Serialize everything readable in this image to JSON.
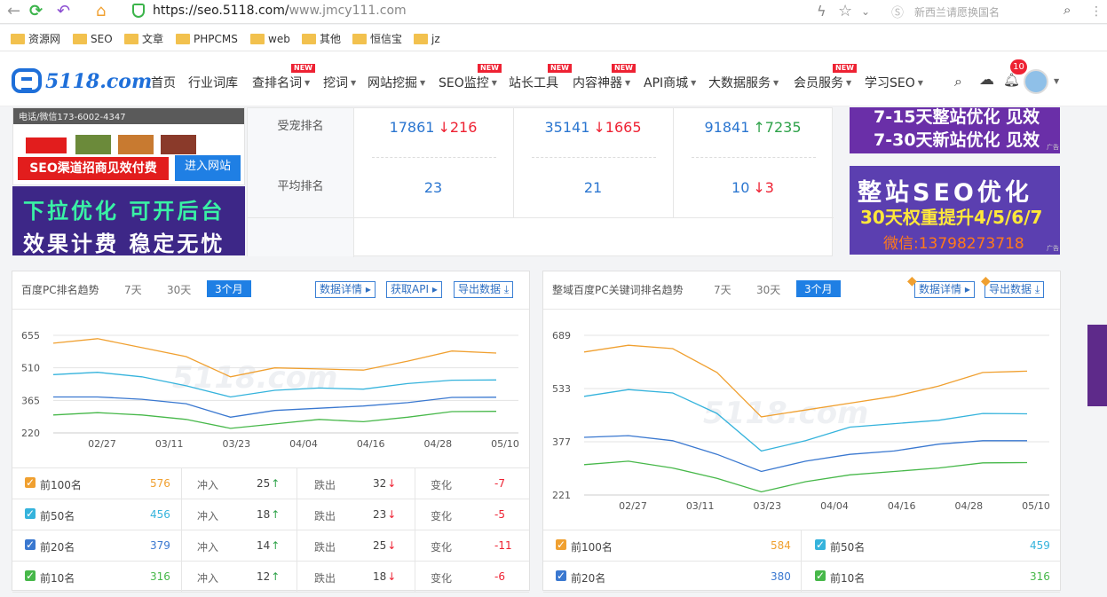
{
  "browser": {
    "url_host": "https://seo.5118.com/",
    "url_path": "www.jmcy111.com",
    "search_placeholder": "新西兰请愿换国名"
  },
  "bookmarks": [
    "资源网",
    "SEO",
    "文章",
    "PHPCMS",
    "web",
    "其他",
    "恒信宝",
    "jz"
  ],
  "site": {
    "logo": "5118.com",
    "nav": [
      {
        "label": "首页",
        "caret": false,
        "badge": ""
      },
      {
        "label": "行业词库",
        "caret": false,
        "badge": ""
      },
      {
        "label": "查排名词",
        "caret": true,
        "badge": "NEW"
      },
      {
        "label": "挖词",
        "caret": true,
        "badge": ""
      },
      {
        "label": "网站挖掘",
        "caret": true,
        "badge": ""
      },
      {
        "label": "SEO监控",
        "caret": true,
        "badge": "NEW"
      },
      {
        "label": "站长工具",
        "caret": false,
        "badge": "NEW"
      },
      {
        "label": "内容神器",
        "caret": true,
        "badge": "NEW"
      },
      {
        "label": "API商城",
        "caret": true,
        "badge": ""
      },
      {
        "label": "大数据服务",
        "caret": true,
        "badge": ""
      },
      {
        "label": "会员服务",
        "caret": true,
        "badge": "NEW"
      },
      {
        "label": "学习SEO",
        "caret": true,
        "badge": ""
      }
    ],
    "notify_count": "10"
  },
  "left_ads": {
    "phone": "电话/微信173-6002-4347",
    "red_btn": "SEO渠道招商见效付费",
    "blue_btn": "进入网站",
    "ad2_line1": "下拉优化  可开后台",
    "ad2_line2": "效果计费  稳定无忧"
  },
  "rank_table": {
    "rows": [
      {
        "label": "受宠排名",
        "cells": [
          {
            "value": "17861",
            "delta": "216",
            "dir": "down"
          },
          {
            "value": "35141",
            "delta": "1665",
            "dir": "down"
          },
          {
            "value": "91841",
            "delta": "7235",
            "dir": "up"
          }
        ]
      },
      {
        "label": "平均排名",
        "cells": [
          {
            "value": "23",
            "delta": "",
            "dir": ""
          },
          {
            "value": "21",
            "delta": "",
            "dir": ""
          },
          {
            "value": "10",
            "delta": "3",
            "dir": "down"
          }
        ]
      }
    ]
  },
  "right_ads": {
    "r1_line1": "7-15天整站优化 见效",
    "r1_line2": "7-30天新站优化 见效",
    "r2_line1": "整站SEO优化",
    "r2_line2": "30天权重提升4/5/6/7",
    "r2_line3": "微信:13798273718",
    "ad_tag": "广告"
  },
  "panel_left": {
    "title": "百度PC排名趋势",
    "tabs": [
      "7天",
      "30天",
      "3个月"
    ],
    "buttons": [
      "数据详情",
      "获取API",
      "导出数据"
    ],
    "watermark": "5118.com",
    "stats": [
      {
        "name": "前100名",
        "value": "576",
        "color": "#f0a030",
        "in_label": "冲入",
        "in": "25",
        "out_label": "跌出",
        "out": "32",
        "chg_label": "变化",
        "chg": "-7"
      },
      {
        "name": "前50名",
        "value": "456",
        "color": "#35b3dc",
        "in_label": "冲入",
        "in": "18",
        "out_label": "跌出",
        "out": "23",
        "chg_label": "变化",
        "chg": "-5"
      },
      {
        "name": "前20名",
        "value": "379",
        "color": "#3a78d0",
        "in_label": "冲入",
        "in": "14",
        "out_label": "跌出",
        "out": "25",
        "chg_label": "变化",
        "chg": "-11"
      },
      {
        "name": "前10名",
        "value": "316",
        "color": "#47b84a",
        "in_label": "冲入",
        "in": "12",
        "out_label": "跌出",
        "out": "18",
        "chg_label": "变化",
        "chg": "-6"
      }
    ]
  },
  "panel_right": {
    "title": "整域百度PC关键词排名趋势",
    "tabs": [
      "7天",
      "30天",
      "3个月"
    ],
    "buttons": [
      "数据详情",
      "导出数据"
    ],
    "watermark": "5118.com",
    "stats": [
      {
        "name": "前100名",
        "value": "584",
        "color": "#f0a030"
      },
      {
        "name": "前50名",
        "value": "459",
        "color": "#35b3dc"
      },
      {
        "name": "前20名",
        "value": "380",
        "color": "#3a78d0"
      },
      {
        "name": "前10名",
        "value": "316",
        "color": "#47b84a"
      }
    ]
  },
  "chart_data": [
    {
      "type": "line",
      "x": [
        "02/27",
        "03/11",
        "03/23",
        "04/04",
        "04/16",
        "04/28",
        "05/10"
      ],
      "y_ticks": [
        655,
        510,
        365,
        220
      ],
      "ylim": [
        220,
        655
      ],
      "series": [
        {
          "name": "前100名",
          "color": "#f0a030",
          "values": [
            620,
            640,
            600,
            560,
            470,
            510,
            505,
            500,
            540,
            585,
            576
          ]
        },
        {
          "name": "前50名",
          "color": "#35b3dc",
          "values": [
            480,
            490,
            470,
            430,
            380,
            410,
            420,
            415,
            440,
            455,
            456
          ]
        },
        {
          "name": "前20名",
          "color": "#3a78d0",
          "values": [
            380,
            380,
            370,
            350,
            290,
            320,
            330,
            340,
            355,
            378,
            379
          ]
        },
        {
          "name": "前10名",
          "color": "#47b84a",
          "values": [
            300,
            310,
            300,
            280,
            240,
            260,
            280,
            270,
            290,
            315,
            316
          ]
        }
      ]
    },
    {
      "type": "line",
      "x": [
        "02/27",
        "03/11",
        "03/23",
        "04/04",
        "04/16",
        "04/28",
        "05/10"
      ],
      "y_ticks": [
        689,
        533,
        377,
        221
      ],
      "ylim": [
        221,
        689
      ],
      "series": [
        {
          "name": "前100名",
          "color": "#f0a030",
          "values": [
            640,
            660,
            650,
            580,
            450,
            470,
            490,
            510,
            540,
            580,
            584
          ]
        },
        {
          "name": "前50名",
          "color": "#35b3dc",
          "values": [
            510,
            530,
            520,
            460,
            350,
            380,
            420,
            430,
            440,
            460,
            459
          ]
        },
        {
          "name": "前20名",
          "color": "#3a78d0",
          "values": [
            390,
            395,
            380,
            340,
            290,
            320,
            340,
            350,
            370,
            380,
            380
          ]
        },
        {
          "name": "前10名",
          "color": "#47b84a",
          "values": [
            310,
            320,
            300,
            270,
            230,
            260,
            280,
            290,
            300,
            315,
            316
          ]
        }
      ]
    }
  ]
}
